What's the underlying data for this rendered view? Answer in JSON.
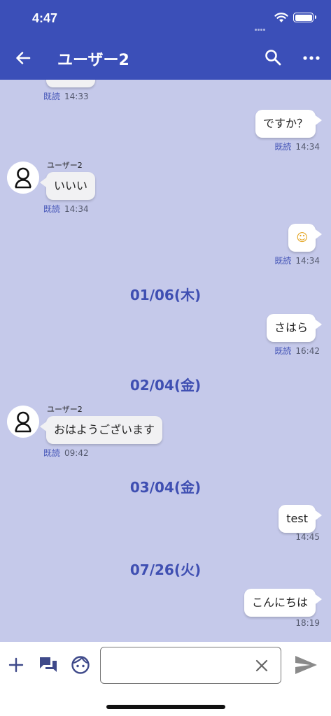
{
  "status_bar": {
    "time": "4:47",
    "battery_percent": 100
  },
  "nav": {
    "title": "ユーザー2",
    "back_icon": "arrow-left-icon",
    "search_icon": "search-icon",
    "more_icon": "more-horizontal-icon"
  },
  "messages": [
    {
      "direction": "in",
      "text": "",
      "read": "既読",
      "time": "14:33"
    },
    {
      "direction": "out",
      "text": "ですか？",
      "read": "既読",
      "time": "14:34"
    },
    {
      "direction": "in",
      "sender": "ユーザー2",
      "text": "いいい",
      "read": "既読",
      "time": "14:34"
    },
    {
      "direction": "out",
      "text": "☺",
      "read": "既読",
      "time": "14:34"
    },
    {
      "direction": "out",
      "text": "さはら",
      "read": "既読",
      "time": "16:42"
    },
    {
      "direction": "in",
      "sender": "ユーザー2",
      "text": "おはようございます",
      "read": "既読",
      "time": "09:42"
    },
    {
      "direction": "out",
      "text": "test",
      "read": "",
      "time": "14:45"
    },
    {
      "direction": "out",
      "text": "こんにちは",
      "read": "",
      "time": "18:19"
    }
  ],
  "date_separators": [
    "01/06(木)",
    "02/04(金)",
    "03/04(金)",
    "07/26(火)"
  ],
  "input_bar": {
    "plus_icon": "plus-icon",
    "stamp_icon": "chat-bubbles-icon",
    "emoji_icon": "face-icon",
    "input_value": "",
    "clear_icon": "close-icon",
    "send_icon": "send-icon"
  },
  "colors": {
    "header": "#3b4fb8",
    "chat_background": "#c5c9ea",
    "accent": "#3f4fb2"
  }
}
